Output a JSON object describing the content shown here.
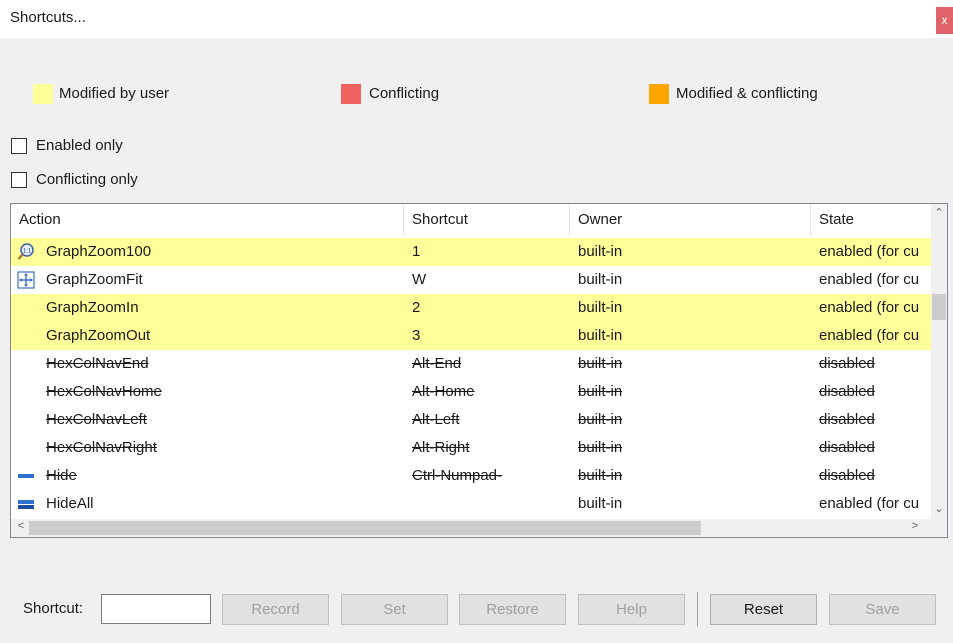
{
  "window": {
    "title": "Shortcuts...",
    "close_glyph": "x"
  },
  "legend": [
    {
      "label": "Modified by user",
      "color": "#ffff99"
    },
    {
      "label": "Conflicting",
      "color": "#f0625f"
    },
    {
      "label": "Modified & conflicting",
      "color": "#ffa500"
    }
  ],
  "filters": {
    "enabled_only": {
      "label": "Enabled only",
      "checked": false
    },
    "conflicting_only": {
      "label": "Conflicting only",
      "checked": false
    }
  },
  "table": {
    "columns": [
      "Action",
      "Shortcut",
      "Owner",
      "State"
    ],
    "rows": [
      {
        "action": "GraphZoom100",
        "shortcut": "1",
        "owner": "built-in",
        "state": "enabled (for cu",
        "highlight": "modified",
        "disabled": false,
        "icon": "zoom-100-icon"
      },
      {
        "action": "GraphZoomFit",
        "shortcut": "W",
        "owner": "built-in",
        "state": "enabled (for cu",
        "highlight": "none",
        "disabled": false,
        "icon": "zoom-fit-icon"
      },
      {
        "action": "GraphZoomIn",
        "shortcut": "2",
        "owner": "built-in",
        "state": "enabled (for cu",
        "highlight": "modified",
        "disabled": false,
        "icon": ""
      },
      {
        "action": "GraphZoomOut",
        "shortcut": "3",
        "owner": "built-in",
        "state": "enabled (for cu",
        "highlight": "modified",
        "disabled": false,
        "icon": ""
      },
      {
        "action": "HexColNavEnd",
        "shortcut": "Alt-End",
        "owner": "built-in",
        "state": "disabled",
        "highlight": "none",
        "disabled": true,
        "icon": ""
      },
      {
        "action": "HexColNavHome",
        "shortcut": "Alt-Home",
        "owner": "built-in",
        "state": "disabled",
        "highlight": "none",
        "disabled": true,
        "icon": ""
      },
      {
        "action": "HexColNavLeft",
        "shortcut": "Alt-Left",
        "owner": "built-in",
        "state": "disabled",
        "highlight": "none",
        "disabled": true,
        "icon": ""
      },
      {
        "action": "HexColNavRight",
        "shortcut": "Alt-Right",
        "owner": "built-in",
        "state": "disabled",
        "highlight": "none",
        "disabled": true,
        "icon": ""
      },
      {
        "action": "Hide",
        "shortcut": "Ctrl-Numpad-",
        "owner": "built-in",
        "state": "disabled",
        "highlight": "none",
        "disabled": true,
        "icon": "hide-icon"
      },
      {
        "action": "HideAll",
        "shortcut": "",
        "owner": "built-in",
        "state": "enabled (for cu",
        "highlight": "none",
        "disabled": false,
        "icon": "hide-all-icon"
      }
    ]
  },
  "bottom": {
    "shortcut_label": "Shortcut:",
    "shortcut_value": "",
    "buttons": [
      {
        "label": "Record",
        "enabled": false
      },
      {
        "label": "Set",
        "enabled": false
      },
      {
        "label": "Restore",
        "enabled": false
      },
      {
        "label": "Help",
        "enabled": false
      },
      {
        "label": "Reset",
        "enabled": true
      },
      {
        "label": "Save",
        "enabled": false
      }
    ]
  }
}
